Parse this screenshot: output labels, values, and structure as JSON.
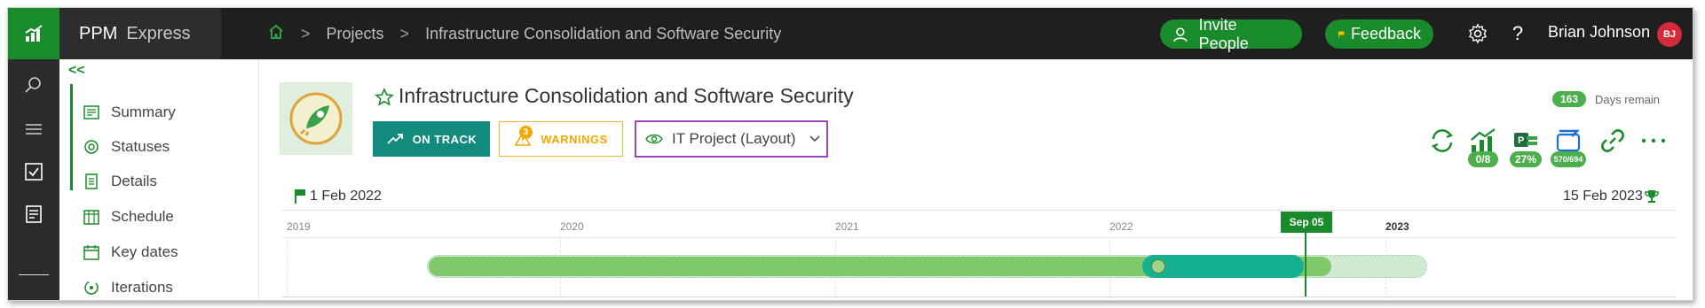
{
  "app": {
    "brand": "PPM",
    "brand_sub": "Express"
  },
  "breadcrumb": {
    "projects": "Projects",
    "current": "Infrastructure Consolidation and Software Security"
  },
  "header": {
    "invite_label": "Invite People",
    "feedback_label": "Feedback",
    "user_name": "Brian Johnson",
    "user_initials": "BJ"
  },
  "nav": {
    "items": [
      {
        "label": "Summary",
        "icon": "summary-icon"
      },
      {
        "label": "Statuses",
        "icon": "statuses-icon"
      },
      {
        "label": "Details",
        "icon": "details-icon"
      },
      {
        "label": "Schedule",
        "icon": "schedule-icon"
      },
      {
        "label": "Key dates",
        "icon": "key-dates-icon"
      },
      {
        "label": "Iterations",
        "icon": "iterations-icon"
      }
    ]
  },
  "project": {
    "title": "Infrastructure Consolidation and Software Security",
    "status_label": "ON TRACK",
    "warnings_label": "WARNINGS",
    "warnings_count": "3",
    "layout_label": "IT Project (Layout)",
    "days_remaining": "163",
    "days_label": "Days remain"
  },
  "actions": {
    "metrics_badge": "0/8",
    "progress_badge": "27%",
    "sync_badge": "570/694"
  },
  "timeline": {
    "start_label": "1 Feb 2022",
    "end_label": "15 Feb 2023",
    "years": [
      "2019",
      "2020",
      "2021",
      "2022",
      "2023"
    ],
    "today_label": "Sep 05"
  },
  "colors": {
    "brand_green": "#1a8b2a",
    "teal": "#138a7e",
    "warning": "#f2a900",
    "highlight": "#a044b8"
  }
}
